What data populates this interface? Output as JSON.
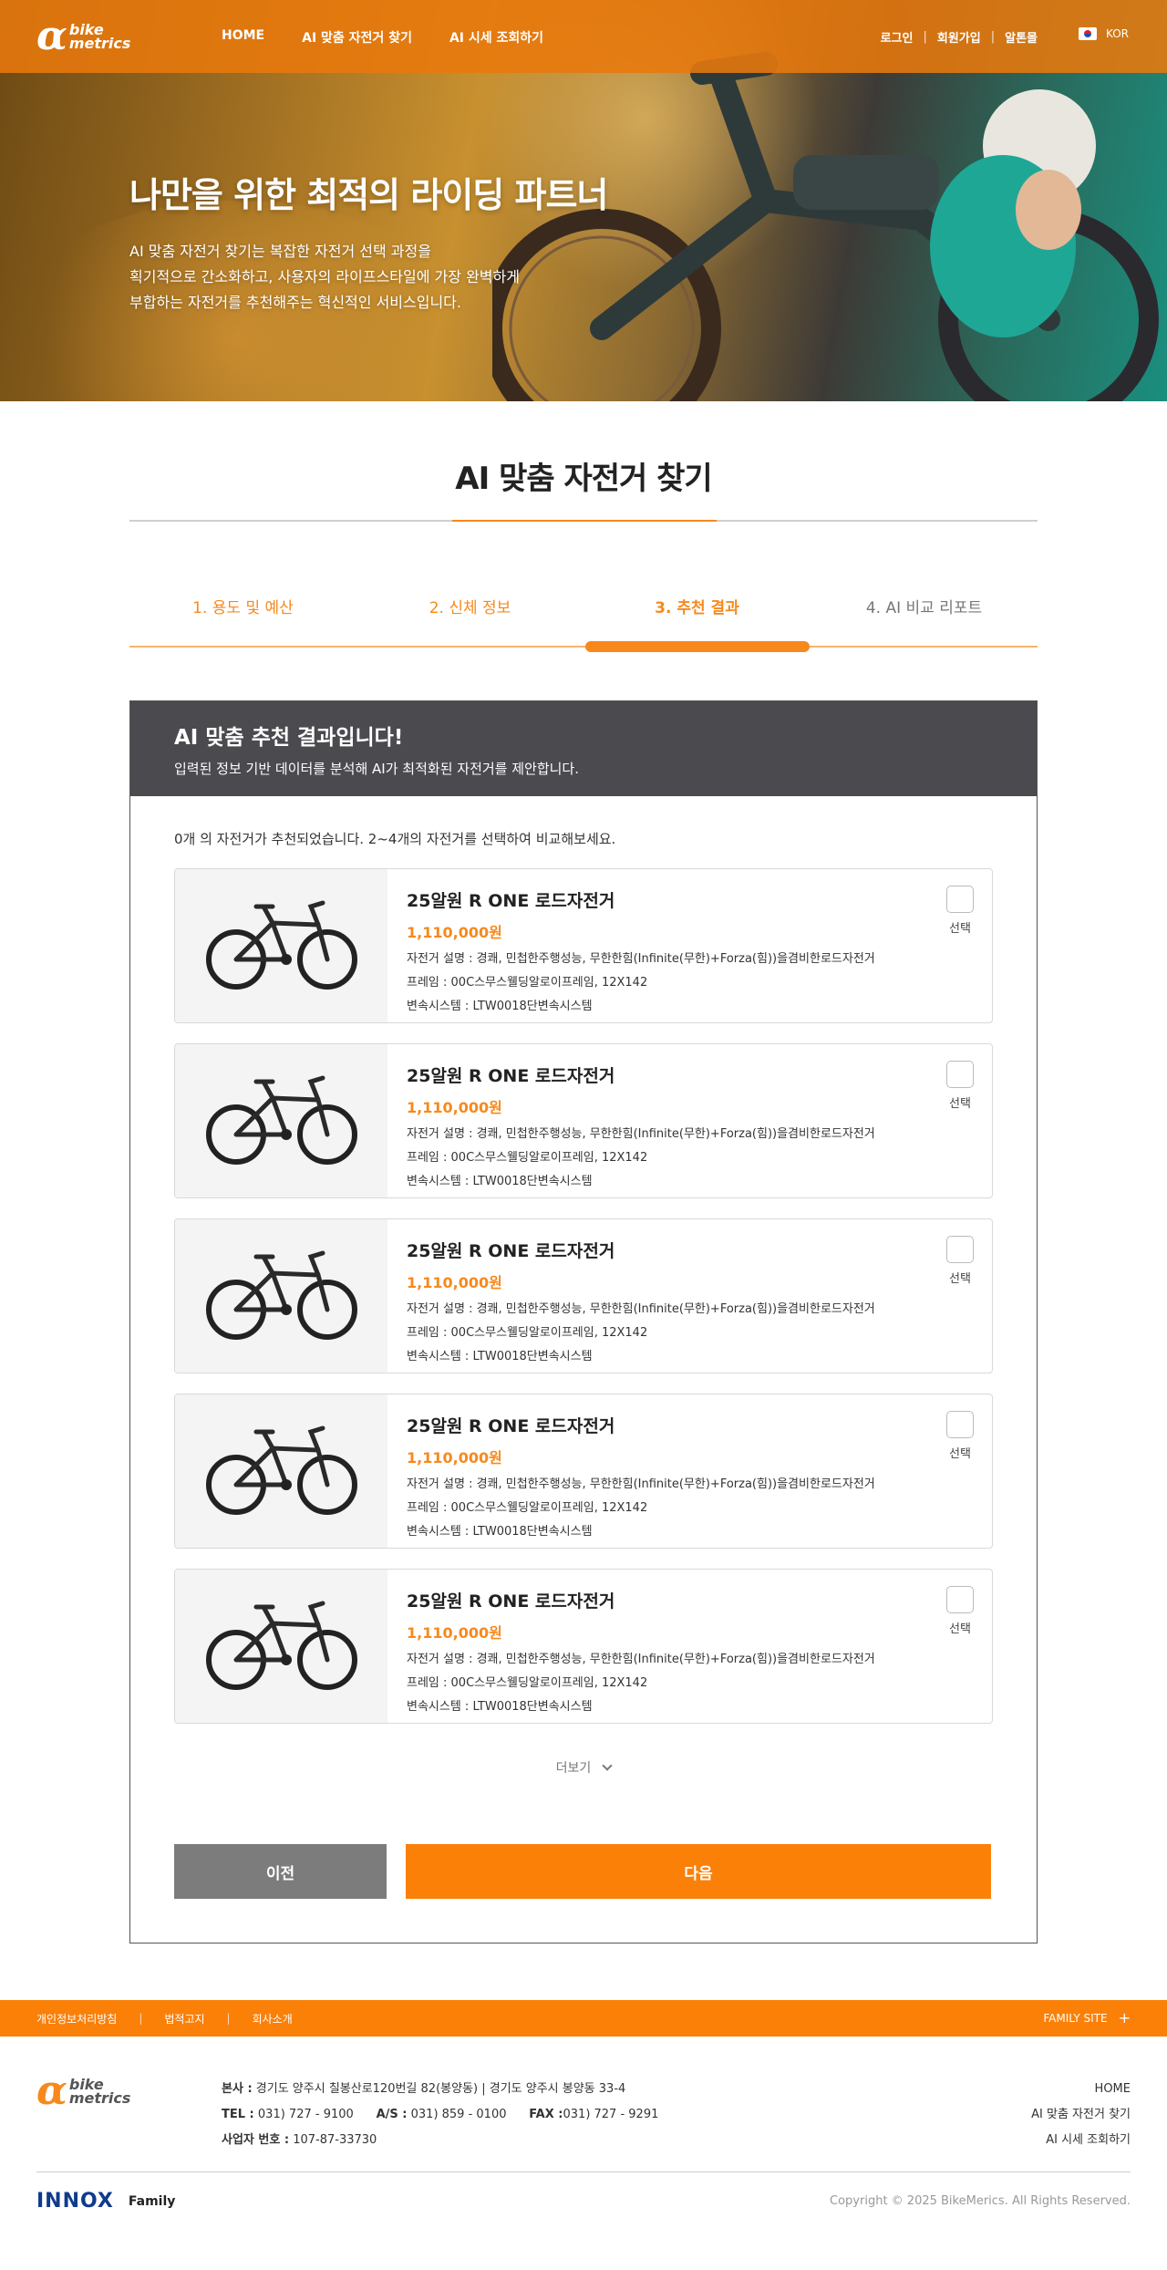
{
  "header": {
    "logo_mark": "α",
    "logo_line1": "bike",
    "logo_line2": "metrics",
    "nav": [
      "HOME",
      "AI 맞춤 자전거 찾기",
      "AI 시세 조회하기"
    ],
    "util": [
      "로그인",
      "회원가입",
      "알톤몰"
    ],
    "lang": "KOR"
  },
  "hero": {
    "title": "나만을 위한 최적의 라이딩 파트너",
    "desc_line1": "AI 맞춤 자전거 찾기는 복잡한 자전거 선택 과정을",
    "desc_line2": "획기적으로 간소화하고, 사용자의 라이프스타일에 가장 완벽하게",
    "desc_line3": "부합하는 자전거를 추천해주는 혁신적인 서비스입니다."
  },
  "section_title": "AI 맞춤 자전거 찾기",
  "steps": [
    {
      "label": "1. 용도 및 예산",
      "color": "#f7891c",
      "bold": false
    },
    {
      "label": "2. 신체 정보",
      "color": "#f7891c",
      "bold": false
    },
    {
      "label": "3. 추천 결과",
      "color": "#f7891c",
      "bold": true
    },
    {
      "label": "4. AI 비교 리포트",
      "color": "#777777",
      "bold": false
    }
  ],
  "result": {
    "title": "AI 맞춤 추천 결과입니다!",
    "subtitle": "입력된 정보 기반 데이터를 분석해 AI가 최적화된 자전거를 제안합니다.",
    "count_text": "0개 의 자전거가 추천되었습니다. 2~4개의 자전거를 선택하여 비교해보세요.",
    "items": [
      {
        "name": "25알원 R ONE 로드자전거",
        "price": "1,110,000원",
        "desc": "자전거 설명 : 경쾌, 민첩한주행성능, 무한한힘(Infinite(무한)+Forza(힘))을겸비한로드자전거",
        "frame": "프레임 : 00C스무스웰딩알로이프레임, 12X142",
        "gear": "변속시스템 : LTW0018단변속시스템",
        "select": "선택"
      },
      {
        "name": "25알원 R ONE 로드자전거",
        "price": "1,110,000원",
        "desc": "자전거 설명 : 경쾌, 민첩한주행성능, 무한한힘(Infinite(무한)+Forza(힘))을겸비한로드자전거",
        "frame": "프레임 : 00C스무스웰딩알로이프레임, 12X142",
        "gear": "변속시스템 : LTW0018단변속시스템",
        "select": "선택"
      },
      {
        "name": "25알원 R ONE 로드자전거",
        "price": "1,110,000원",
        "desc": "자전거 설명 : 경쾌, 민첩한주행성능, 무한한힘(Infinite(무한)+Forza(힘))을겸비한로드자전거",
        "frame": "프레임 : 00C스무스웰딩알로이프레임, 12X142",
        "gear": "변속시스템 : LTW0018단변속시스템",
        "select": "선택"
      },
      {
        "name": "25알원 R ONE 로드자전거",
        "price": "1,110,000원",
        "desc": "자전거 설명 : 경쾌, 민첩한주행성능, 무한한힘(Infinite(무한)+Forza(힘))을겸비한로드자전거",
        "frame": "프레임 : 00C스무스웰딩알로이프레임, 12X142",
        "gear": "변속시스템 : LTW0018단변속시스템",
        "select": "선택"
      },
      {
        "name": "25알원 R ONE 로드자전거",
        "price": "1,110,000원",
        "desc": "자전거 설명 : 경쾌, 민첩한주행성능, 무한한힘(Infinite(무한)+Forza(힘))을겸비한로드자전거",
        "frame": "프레임 : 00C스무스웰딩알로이프레임, 12X142",
        "gear": "변속시스템 : LTW0018단변속시스템",
        "select": "선택"
      }
    ],
    "more_label": "더보기",
    "prev_label": "이전",
    "next_label": "다음"
  },
  "footer": {
    "links": [
      "개인정보처리방침",
      "법적고지",
      "회사소개"
    ],
    "family_site": "FAMILY SITE",
    "hq_label": "본사 :",
    "hq_value": "경기도 양주시 칠봉산로120번길 82(봉양동) | 경기도 양주시 봉양동 33-4",
    "tel_label": "TEL :",
    "tel_value": "031) 727 - 9100",
    "as_label": "A/S :",
    "as_value": "031) 859 - 0100",
    "fax_label": "FAX :",
    "fax_value": "031) 727 - 9291",
    "biz_label": "사업자 번호 :",
    "biz_value": "107-87-33730",
    "right_links": [
      "HOME",
      "AI 맞춤 자전거 찾기",
      "AI 시세 조회하기"
    ],
    "brand": "INNOX",
    "brand_suffix": "Family",
    "copyright": "Copyright © 2025 BikeMerics. All Rights Reserved."
  },
  "colors": {
    "accent": "#f7891c",
    "header": "#e8790c",
    "panel_head": "#4a4a4f",
    "prev_button": "#7c7c7c"
  },
  "icons": [
    "flag-icon",
    "bike-image",
    "chevron-down-icon",
    "plus-icon"
  ]
}
